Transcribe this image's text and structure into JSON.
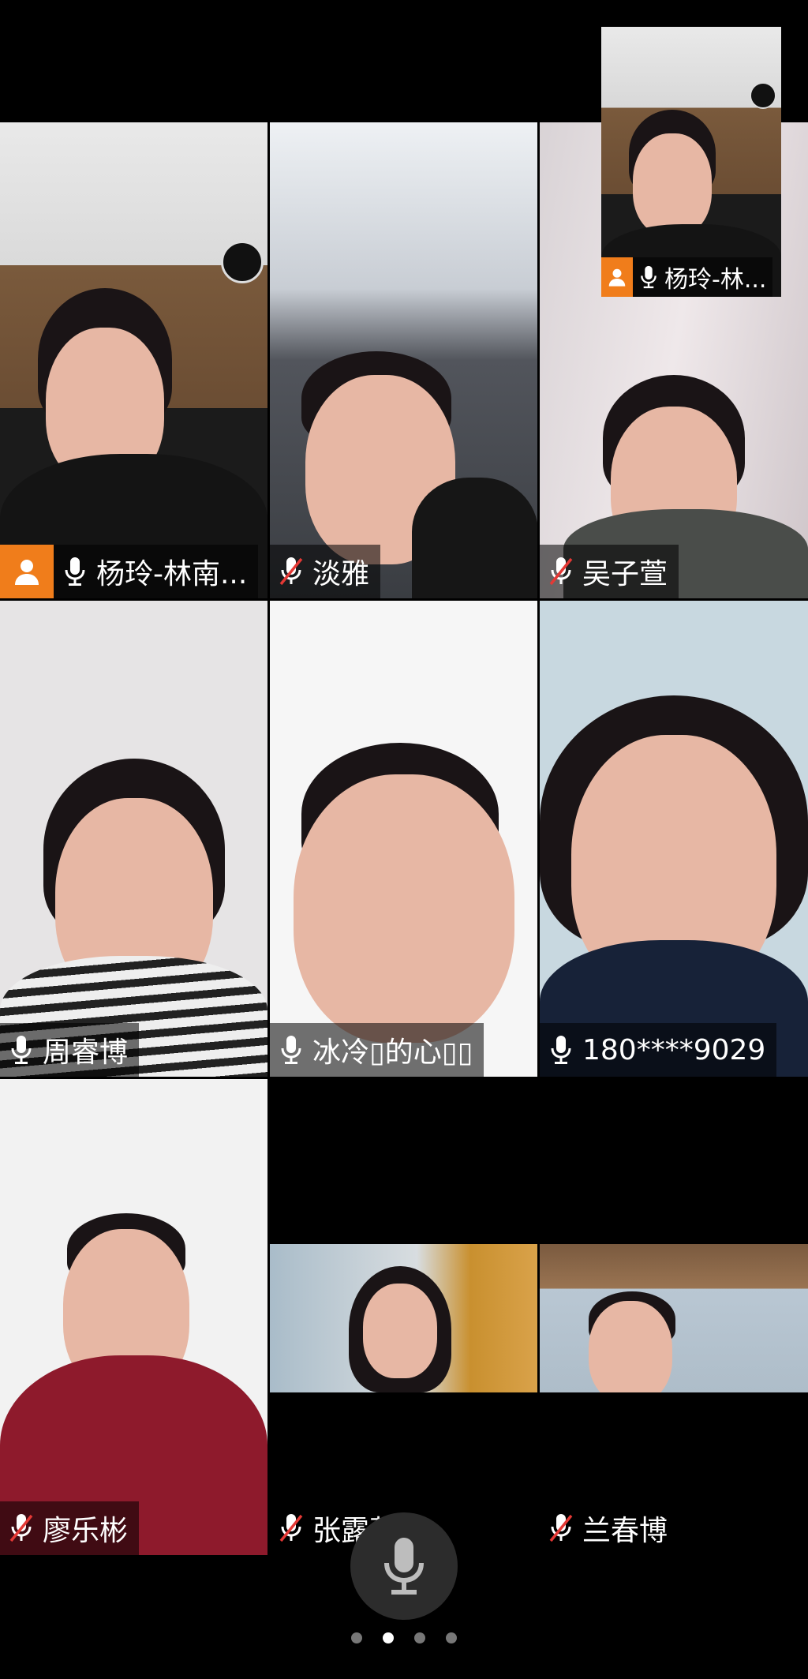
{
  "participants": [
    {
      "name": "杨玲-林南...",
      "mic": "on",
      "host": true
    },
    {
      "name": "淡雅",
      "mic": "muted"
    },
    {
      "name": "吴子萱",
      "mic": "muted"
    },
    {
      "name": "周睿博",
      "mic": "on"
    },
    {
      "name": "冰冷▯的心▯▯",
      "mic": "on"
    },
    {
      "name": "180****9029",
      "mic": "on"
    },
    {
      "name": "廖乐彬",
      "mic": "muted"
    },
    {
      "name": "张露萱",
      "mic": "muted"
    },
    {
      "name": "兰春博",
      "mic": "muted"
    }
  ],
  "self_view": {
    "name": "杨玲-林...",
    "mic": "on",
    "host": true
  },
  "controls": {
    "mic_button_icon": "microphone-icon"
  },
  "pager": {
    "pages": 4,
    "current": 2
  },
  "colors": {
    "host_badge": "#f07d1b",
    "mute_red": "#e53935",
    "background": "#000000"
  }
}
